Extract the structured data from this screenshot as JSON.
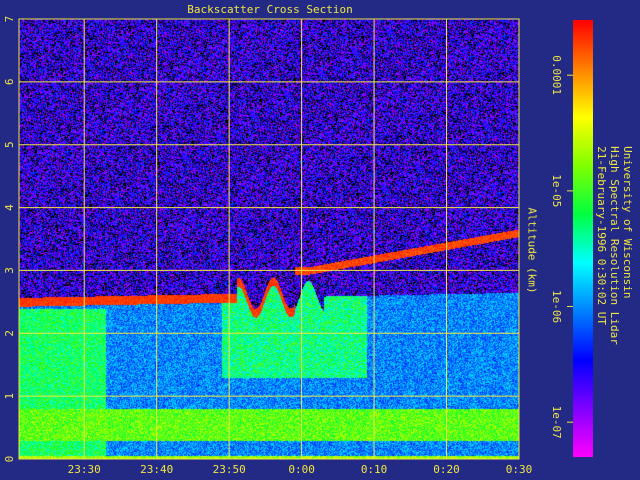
{
  "chart_data": {
    "type": "heatmap",
    "title": "Backscatter Cross Section",
    "ylabel": "Altitude (km)",
    "xlabel": "",
    "x_ticks": [
      "23:30",
      "23:40",
      "23:50",
      "0:00",
      "0:10",
      "0:20",
      "0:30"
    ],
    "y_ticks": [
      "0",
      "1",
      "2",
      "3",
      "4",
      "5",
      "6",
      "7"
    ],
    "xlim": [
      "23:21",
      "0:30"
    ],
    "ylim": [
      0,
      7
    ],
    "colorbar": {
      "scale": "log",
      "range": [
        5e-08,
        0.0003
      ],
      "tick_labels": [
        "0.0001",
        "1e-05",
        "1e-06",
        "1e-07"
      ],
      "colors": [
        "#ff0000",
        "#ff8000",
        "#ffff00",
        "#80ff00",
        "#00ff40",
        "#00ffff",
        "#0080ff",
        "#0000ff",
        "#8000ff",
        "#ff00ff"
      ]
    },
    "features": {
      "boundary_layer_top_km": 2.5,
      "upper_cloud_layer_km": [
        3.0,
        3.6
      ],
      "dense_lower_layer_km": [
        0.3,
        0.8
      ]
    },
    "grid": true,
    "grid_color": "#f2e640"
  },
  "info": {
    "line1": "University of Wisconsin",
    "line2": "High Spectral Resolution Lidar",
    "line3": "21-February-1996  0:30:02 UT"
  }
}
